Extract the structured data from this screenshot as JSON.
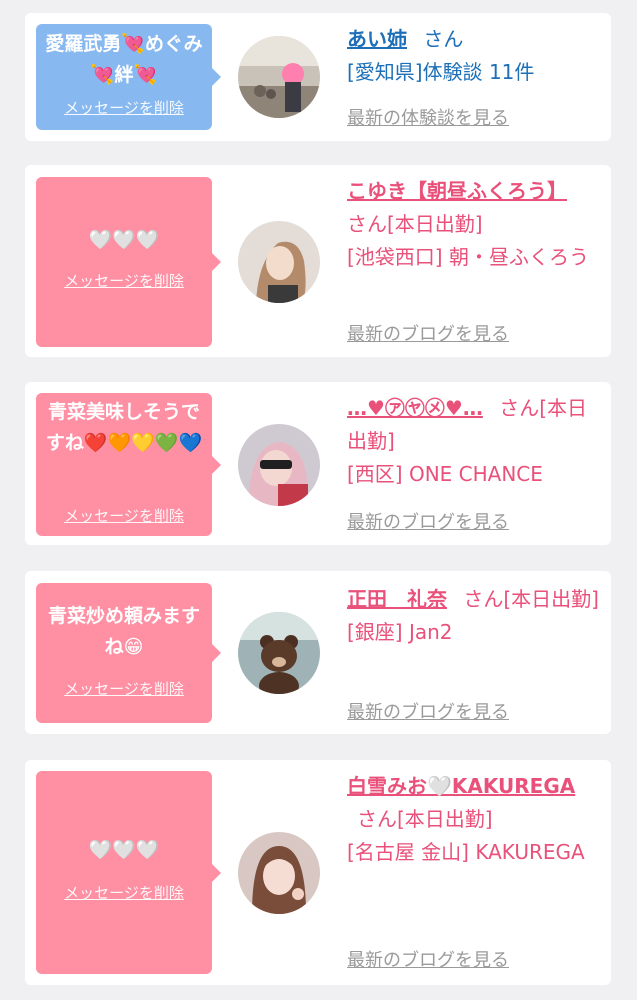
{
  "colors": {
    "pink_accent": "#e9517a",
    "pink_bubble": "#ff8fa3",
    "blue_accent": "#1d6fb8",
    "blue_bubble": "#87b8f0",
    "link_gray": "#9a9a9a"
  },
  "common": {
    "delete_label": "メッセージを削除"
  },
  "cards": [
    {
      "message": "愛羅武勇💘めぐみ💘絆💘",
      "name": "あい姉",
      "san": "さん",
      "detail": "[愛知県]体験談 11件",
      "more": "最新の体験談を見る",
      "avatar_icon": "user-photo"
    },
    {
      "message": "🤍🤍🤍",
      "name": "こゆき【朝昼ふくろう】",
      "san": "さん[本日出勤]",
      "detail": "[池袋西口] 朝・昼ふくろう",
      "more": "最新のブログを見る",
      "avatar_icon": "user-photo"
    },
    {
      "message": "青菜美味しそうですね❤️🧡💛💚💙",
      "name": "…♥㋐㋳㋱♥…",
      "san": "さん[本日出勤]",
      "detail": "[西区] ONE CHANCE",
      "more": "最新のブログを見る",
      "avatar_icon": "user-photo"
    },
    {
      "message": "青菜炒め頼みますね😁",
      "name": "正田　礼奈",
      "san": "さん[本日出勤]",
      "detail": "[銀座] Jan2",
      "more": "最新のブログを見る",
      "avatar_icon": "bear-photo"
    },
    {
      "message": "🤍🤍🤍",
      "name": "白雪みお🤍KAKUREGA",
      "san": "さん[本日出勤]",
      "detail": "[名古屋 金山] KAKUREGA",
      "more": "最新のブログを見る",
      "avatar_icon": "user-photo"
    }
  ]
}
